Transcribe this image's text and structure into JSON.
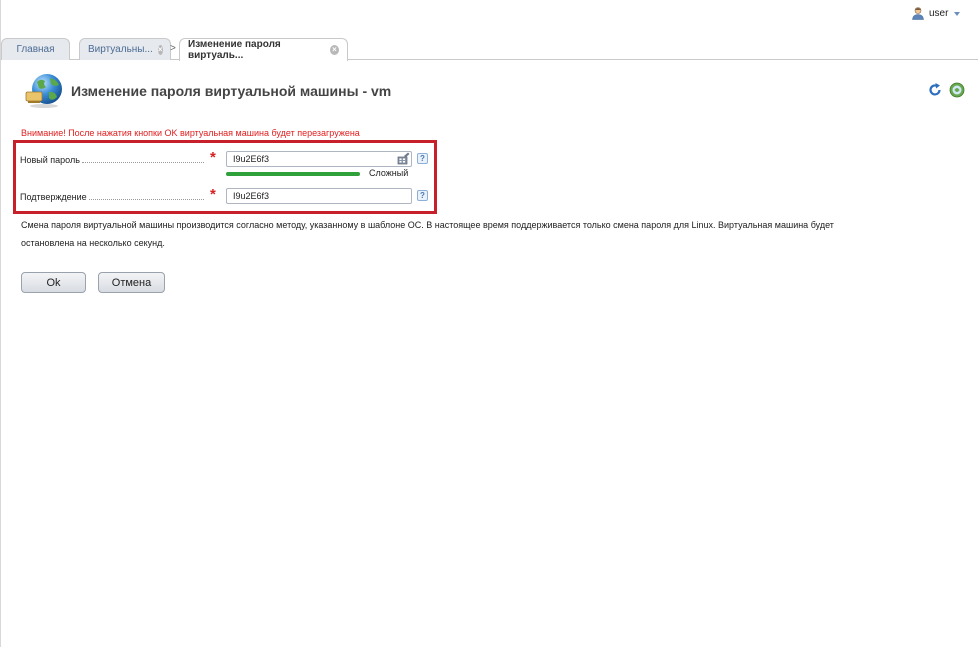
{
  "user_menu": {
    "name": "user"
  },
  "tabs": [
    {
      "label": "Главная"
    },
    {
      "label": "Виртуальны..."
    },
    {
      "label": "Изменение пароля виртуаль..."
    }
  ],
  "header": {
    "title": "Изменение пароля виртуальной машины - vm"
  },
  "warning": "Внимание! После нажатия кнопки OK виртуальная машина будет перезагружена",
  "form": {
    "new_password": {
      "label": "Новый пароль",
      "value": "I9u2E6f3",
      "required_mark": "*"
    },
    "strength": {
      "label": "Сложный",
      "fraction": 1.0,
      "color": "#2ea13a"
    },
    "confirm": {
      "label": "Подтверждение",
      "value": "I9u2E6f3",
      "required_mark": "*"
    },
    "help_mark": "?"
  },
  "description": "Смена пароля виртуальной машины производится согласно методу, указанному в шаблоне ОС. В настоящее время поддерживается только смена пароля для Linux. Виртуальная машина будет остановлена на несколько секунд.",
  "buttons": {
    "ok": "Ok",
    "cancel": "Отмена"
  },
  "colors": {
    "accent": "#4b6b94",
    "warning": "#e02020",
    "highlight_border": "#c8202a",
    "required": "#d42020"
  },
  "icons": [
    "user-icon",
    "tab-close-icon",
    "globe-icon",
    "refresh-icon",
    "help-globe-icon",
    "password-generator-icon",
    "help-icon"
  ]
}
